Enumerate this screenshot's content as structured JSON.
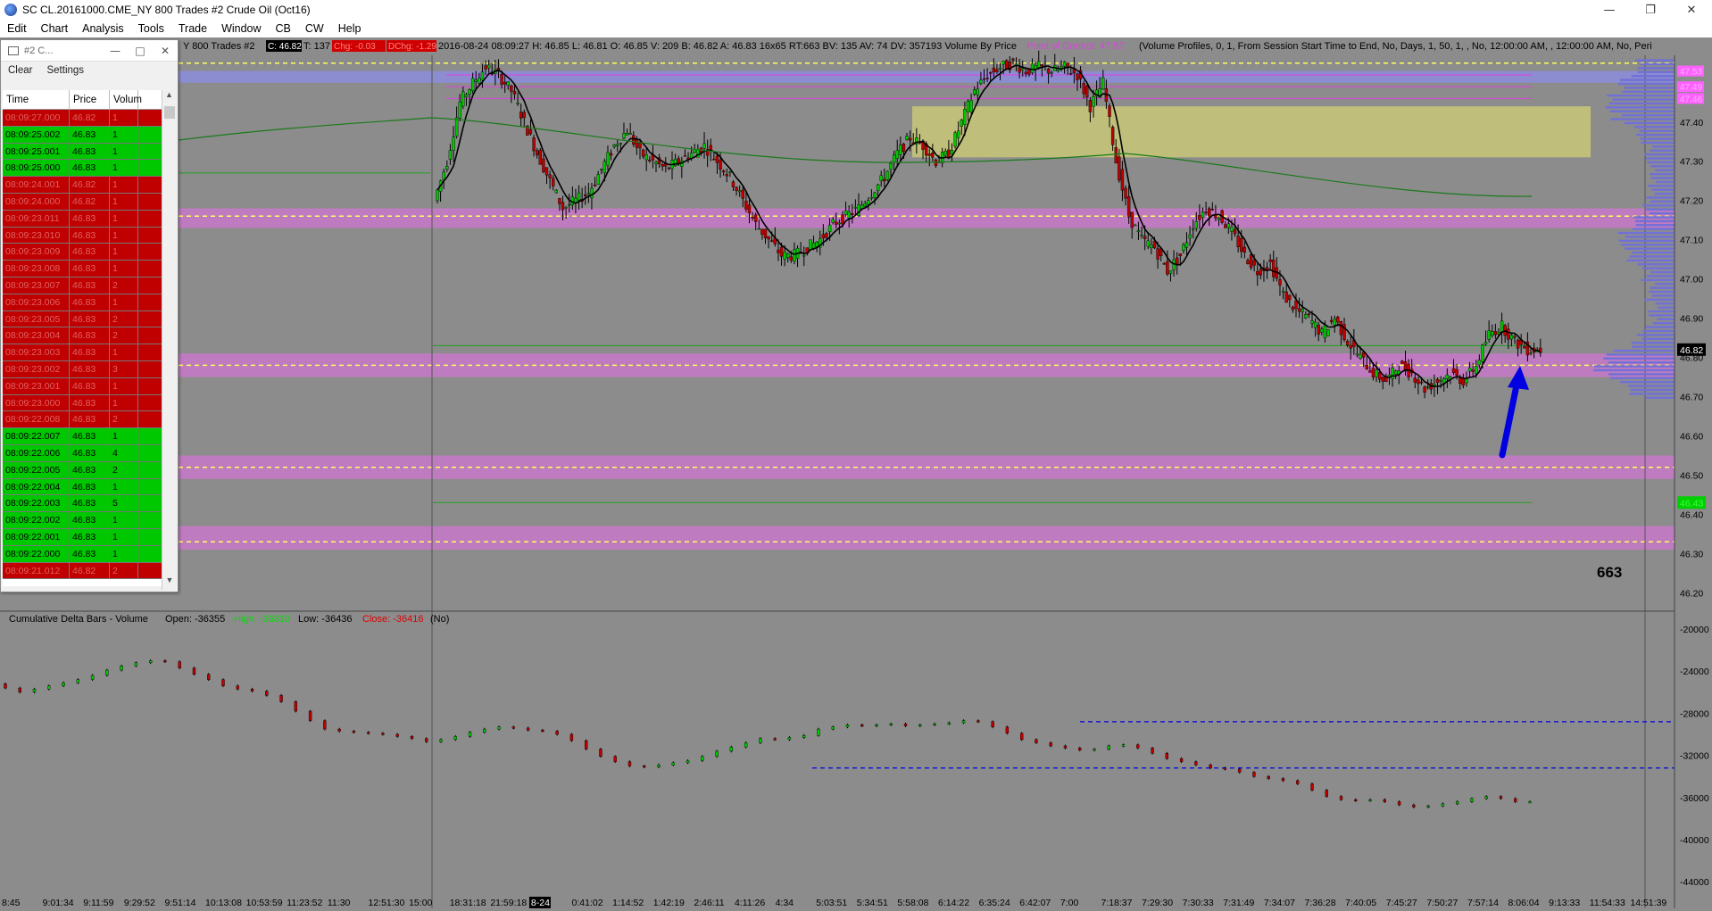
{
  "window": {
    "title": "SC CL.20161000.CME_NY  800 Trades  #2  Crude Oil (Oct16)",
    "min": "—",
    "restore": "❐",
    "close": "✕"
  },
  "menu": [
    "Edit",
    "Chart",
    "Analysis",
    "Tools",
    "Trade",
    "Window",
    "CB",
    "CW",
    "Help"
  ],
  "chart_header": {
    "prefix": "Y  800 Trades  #2",
    "close_badge": "C: 46.82",
    "trades": "T: 137",
    "chg": "Chg: -0.03",
    "dchg": "DChg: -1.29",
    "stats": "2016-08-24 08:09:27 H: 46.85 L: 46.81 O: 46.85 V: 209 B: 46.82 A: 46.83 16x65 RT:663 BV: 135 AV: 74 DV: 357193 Volume By Price",
    "poc": "Point of Control: 47.57",
    "profiles": "(Volume Profiles, 0, 1, From Session Start Time to End, No, Days, 1, 50, 1, , No, 12:00:00 AM, , 12:00:00 AM, No, Peri"
  },
  "price_axis": {
    "ticks": [
      "47.40",
      "47.30",
      "47.20",
      "47.10",
      "47.00",
      "46.90",
      "46.80",
      "46.70",
      "46.60",
      "46.50",
      "46.40",
      "46.30",
      "46.20"
    ],
    "badges": [
      "47.53",
      "47.49",
      "47.46"
    ],
    "last_price": "46.82",
    "green_badge": "46.43"
  },
  "bar_counter": "663",
  "delta_header": {
    "title": "Cumulative Delta Bars - Volume",
    "open": "Open: -36355",
    "high": "High: -36310",
    "low": "Low: -36436",
    "close": "Close: -36416",
    "flag": "(No)"
  },
  "delta_axis": [
    "-20000",
    "-24000",
    "-28000",
    "-32000",
    "-36000",
    "-40000",
    "-44000"
  ],
  "time_axis": [
    "8:45",
    "9:01:34",
    "9:11:59",
    "9:29:52",
    "9:51:14",
    "10:13:08",
    "10:53:59",
    "11:23:52",
    "11:30",
    "12:51:30",
    "15:00",
    "18:31:18",
    "21:59:18",
    "8-24",
    "0:41:02",
    "1:14:52",
    "1:42:19",
    "2:46:11",
    "4:11:26",
    "4:34",
    "5:03:51",
    "5:34:51",
    "5:58:08",
    "6:14:22",
    "6:35:24",
    "6:42:07",
    "7:00",
    "7:18:37",
    "7:29:30",
    "7:30:33",
    "7:31:49",
    "7:34:07",
    "7:36:28",
    "7:40:05",
    "7:45:27",
    "7:50:27",
    "7:57:14",
    "8:06:04",
    "9:13:33",
    "11:54:33",
    "14:51:39"
  ],
  "time_and_sales": {
    "title": "#2 C...",
    "toolbar": {
      "clear": "Clear",
      "settings": "Settings"
    },
    "columns": [
      "Time",
      "Price",
      "Volum"
    ],
    "rows": [
      {
        "t": "08:09:27.000",
        "p": "46.82",
        "v": "1",
        "side": "dn"
      },
      {
        "t": "08:09:25.002",
        "p": "46.83",
        "v": "1",
        "side": "up"
      },
      {
        "t": "08:09:25.001",
        "p": "46.83",
        "v": "1",
        "side": "up"
      },
      {
        "t": "08:09:25.000",
        "p": "46.83",
        "v": "1",
        "side": "up"
      },
      {
        "t": "08:09:24.001",
        "p": "46.82",
        "v": "1",
        "side": "dn"
      },
      {
        "t": "08:09:24.000",
        "p": "46.82",
        "v": "1",
        "side": "dn"
      },
      {
        "t": "08:09:23.011",
        "p": "46.83",
        "v": "1",
        "side": "dn"
      },
      {
        "t": "08:09:23.010",
        "p": "46.83",
        "v": "1",
        "side": "dn"
      },
      {
        "t": "08:09:23.009",
        "p": "46.83",
        "v": "1",
        "side": "dn"
      },
      {
        "t": "08:09:23.008",
        "p": "46.83",
        "v": "1",
        "side": "dn"
      },
      {
        "t": "08:09:23.007",
        "p": "46.83",
        "v": "2",
        "side": "dn"
      },
      {
        "t": "08:09:23.006",
        "p": "46.83",
        "v": "1",
        "side": "dn"
      },
      {
        "t": "08:09:23.005",
        "p": "46.83",
        "v": "2",
        "side": "dn"
      },
      {
        "t": "08:09:23.004",
        "p": "46.83",
        "v": "2",
        "side": "dn"
      },
      {
        "t": "08:09:23.003",
        "p": "46.83",
        "v": "1",
        "side": "dn"
      },
      {
        "t": "08:09:23.002",
        "p": "46.83",
        "v": "3",
        "side": "dn"
      },
      {
        "t": "08:09:23.001",
        "p": "46.83",
        "v": "1",
        "side": "dn"
      },
      {
        "t": "08:09:23.000",
        "p": "46.83",
        "v": "1",
        "side": "dn"
      },
      {
        "t": "08:09:22.008",
        "p": "46.83",
        "v": "2",
        "side": "dn"
      },
      {
        "t": "08:09:22.007",
        "p": "46.83",
        "v": "1",
        "side": "up"
      },
      {
        "t": "08:09:22.006",
        "p": "46.83",
        "v": "4",
        "side": "up"
      },
      {
        "t": "08:09:22.005",
        "p": "46.83",
        "v": "2",
        "side": "up"
      },
      {
        "t": "08:09:22.004",
        "p": "46.83",
        "v": "1",
        "side": "up"
      },
      {
        "t": "08:09:22.003",
        "p": "46.83",
        "v": "5",
        "side": "up"
      },
      {
        "t": "08:09:22.002",
        "p": "46.83",
        "v": "1",
        "side": "up"
      },
      {
        "t": "08:09:22.001",
        "p": "46.83",
        "v": "1",
        "side": "up"
      },
      {
        "t": "08:09:22.000",
        "p": "46.83",
        "v": "1",
        "side": "up"
      },
      {
        "t": "08:09:21.012",
        "p": "46.82",
        "v": "2",
        "side": "dn"
      }
    ]
  },
  "colors": {
    "bg": "#8c8c8c",
    "up": "#00c800",
    "down": "#c00000",
    "zone": "#c878c8",
    "poc_zone": "#8c8cdc",
    "value_area": "#c8c878",
    "ma": "#000000",
    "ma_long": "#1a7a1a",
    "arrow": "#0000e0"
  },
  "price_series": [
    47.2,
    47.3,
    47.45,
    47.5,
    47.54,
    47.52,
    47.48,
    47.4,
    47.32,
    47.25,
    47.18,
    47.2,
    47.22,
    47.28,
    47.34,
    47.38,
    47.32,
    47.3,
    47.28,
    47.3,
    47.32,
    47.34,
    47.3,
    47.26,
    47.2,
    47.14,
    47.1,
    47.06,
    47.06,
    47.08,
    47.1,
    47.14,
    47.16,
    47.18,
    47.22,
    47.26,
    47.32,
    47.36,
    47.34,
    47.3,
    47.32,
    47.4,
    47.48,
    47.52,
    47.54,
    47.55,
    47.53,
    47.54,
    47.53,
    47.54,
    47.52,
    47.44,
    47.5,
    47.3,
    47.16,
    47.1,
    47.08,
    47.02,
    47.06,
    47.14,
    47.18,
    47.16,
    47.12,
    47.06,
    47.02,
    47.04,
    46.96,
    46.92,
    46.9,
    46.86,
    46.9,
    46.84,
    46.8,
    46.76,
    46.74,
    46.78,
    46.76,
    46.72,
    46.74,
    46.76,
    46.74,
    46.78,
    46.86,
    46.88,
    46.84,
    46.82
  ],
  "delta_series": [
    -25200,
    -25600,
    -26000,
    -25700,
    -25400,
    -25100,
    -24800,
    -24400,
    -23900,
    -23500,
    -23200,
    -23000,
    -23100,
    -23700,
    -24300,
    -24800,
    -25400,
    -25700,
    -25900,
    -26300,
    -26900,
    -27800,
    -28700,
    -29500,
    -29700,
    -29800,
    -29900,
    -30000,
    -30200,
    -30400,
    -30700,
    -30500,
    -30200,
    -29800,
    -29500,
    -29300,
    -29400,
    -29600,
    -29700,
    -30000,
    -30600,
    -31400,
    -32100,
    -32600,
    -33000,
    -33100,
    -32900,
    -32700,
    -32500,
    -32100,
    -31600,
    -31200,
    -30800,
    -30400,
    -30500,
    -30300,
    -30100,
    -29500,
    -29300,
    -29100,
    -29200,
    -29100,
    -29000,
    -29200,
    -29100,
    -29000,
    -28900,
    -28700,
    -28800,
    -29300,
    -29900,
    -30500,
    -30800,
    -31100,
    -31300,
    -31500,
    -31400,
    -31100,
    -31000,
    -31300,
    -31800,
    -32300,
    -32600,
    -32900,
    -33200,
    -33300,
    -33600,
    -34000,
    -34200,
    -34400,
    -34700,
    -35300,
    -35900,
    -36200,
    -36300,
    -36200,
    -36400,
    -36700,
    -36900,
    -36800,
    -36600,
    -36400,
    -36100,
    -35900,
    -36100,
    -36400
  ]
}
